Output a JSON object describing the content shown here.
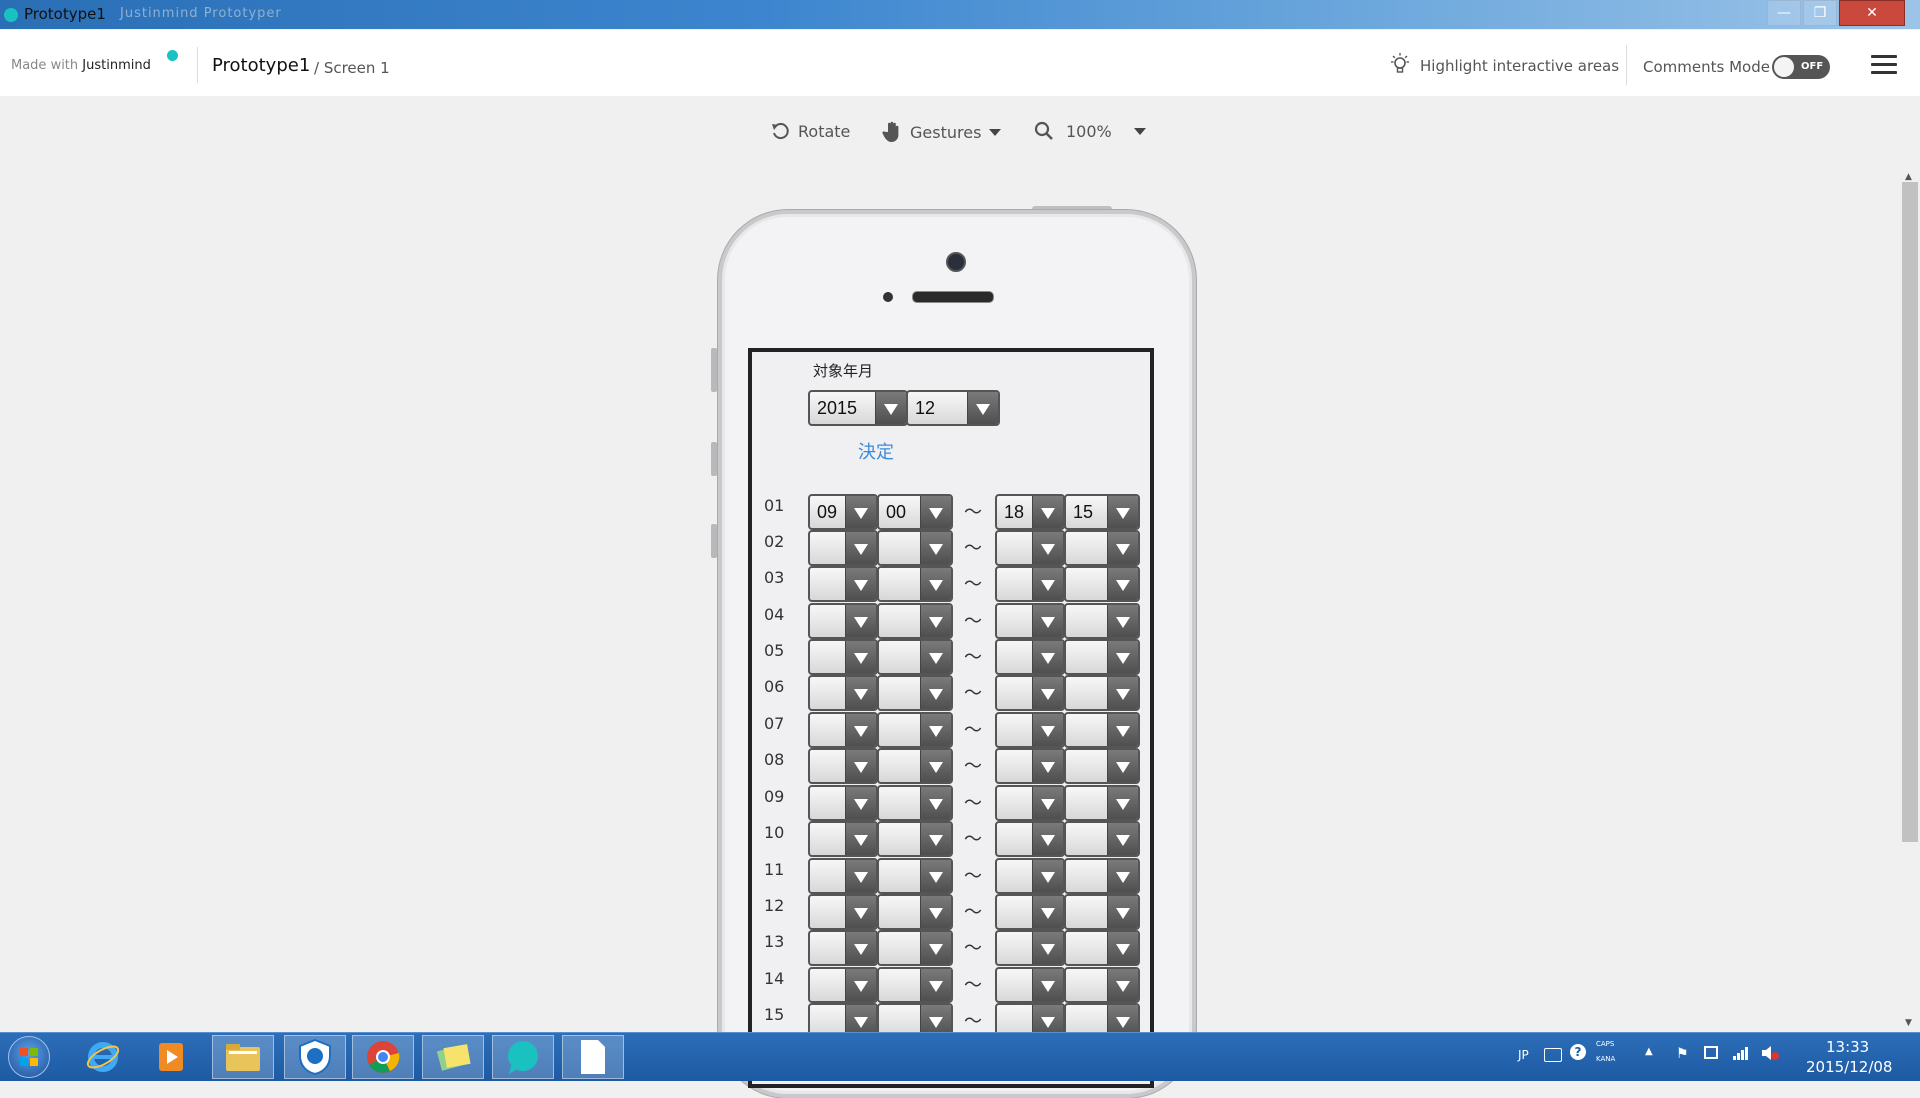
{
  "window": {
    "title": "Prototype1",
    "ghost_title": "Justinmind Prototyper"
  },
  "header": {
    "made_with": "Made with",
    "brand": "Justinmind",
    "project_title": "Prototype1",
    "screen_name": "/ Screen 1",
    "highlight_label": "Highlight interactive areas",
    "comments_label": "Comments Mode",
    "toggle_state": "OFF"
  },
  "toolbar": {
    "rotate_label": "Rotate",
    "gestures_label": "Gestures",
    "zoom_label": "100%"
  },
  "screen": {
    "month_label": "対象年月",
    "year_value": "2015",
    "month_value": "12",
    "decide_label": "決定",
    "tilde": "～",
    "rows": [
      {
        "day": "01",
        "start_h": "09",
        "start_m": "00",
        "end_h": "18",
        "end_m": "15"
      },
      {
        "day": "02",
        "start_h": "",
        "start_m": "",
        "end_h": "",
        "end_m": ""
      },
      {
        "day": "03",
        "start_h": "",
        "start_m": "",
        "end_h": "",
        "end_m": ""
      },
      {
        "day": "04",
        "start_h": "",
        "start_m": "",
        "end_h": "",
        "end_m": ""
      },
      {
        "day": "05",
        "start_h": "",
        "start_m": "",
        "end_h": "",
        "end_m": ""
      },
      {
        "day": "06",
        "start_h": "",
        "start_m": "",
        "end_h": "",
        "end_m": ""
      },
      {
        "day": "07",
        "start_h": "",
        "start_m": "",
        "end_h": "",
        "end_m": ""
      },
      {
        "day": "08",
        "start_h": "",
        "start_m": "",
        "end_h": "",
        "end_m": ""
      },
      {
        "day": "09",
        "start_h": "",
        "start_m": "",
        "end_h": "",
        "end_m": ""
      },
      {
        "day": "10",
        "start_h": "",
        "start_m": "",
        "end_h": "",
        "end_m": ""
      },
      {
        "day": "11",
        "start_h": "",
        "start_m": "",
        "end_h": "",
        "end_m": ""
      },
      {
        "day": "12",
        "start_h": "",
        "start_m": "",
        "end_h": "",
        "end_m": ""
      },
      {
        "day": "13",
        "start_h": "",
        "start_m": "",
        "end_h": "",
        "end_m": ""
      },
      {
        "day": "14",
        "start_h": "",
        "start_m": "",
        "end_h": "",
        "end_m": ""
      },
      {
        "day": "15",
        "start_h": "",
        "start_m": "",
        "end_h": "",
        "end_m": ""
      }
    ]
  },
  "taskbar": {
    "apps": [
      "windows-start",
      "internet-explorer",
      "media-player",
      "file-explorer",
      "hp-support",
      "chrome",
      "sticky-notes",
      "justinmind",
      "blank-document"
    ],
    "tray_lang": "JP",
    "tray_caps": "CAPS",
    "tray_kana": "KANA",
    "time": "13:33",
    "date": "2015/12/08"
  },
  "colors": {
    "accent": "#19c1c1",
    "link": "#3b8cd8",
    "taskbar": "#1d5aa3"
  }
}
